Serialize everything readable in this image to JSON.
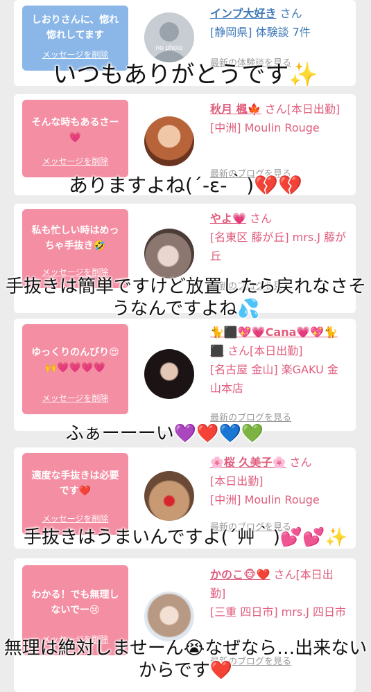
{
  "cards": [
    {
      "message": "しおりさんに、惚れ惚れしてます",
      "delete_label": "メッセージを削除",
      "avatar_label": "no photo",
      "name": "インプ大好き",
      "suffix": "さん",
      "area": "[静岡県] 体験談 7件",
      "latest": "最新の体験談を見る"
    },
    {
      "message": "そんな時もあるさー💗",
      "delete_label": "メッセージを削除",
      "name": "秋月 楓🍁",
      "suffix": "さん[本日出勤]",
      "area": "[中洲] Moulin Rouge",
      "latest": "最新のブログを見る"
    },
    {
      "message": "私も忙しい時はめっちゃ手抜き🤣",
      "delete_label": "メッセージを削除",
      "name": "やよ💗",
      "suffix": "さん",
      "area": "[名東区 藤が丘] mrs.J 藤が丘",
      "latest": "最新のブログを見る"
    },
    {
      "message": "ゆっくりのんびり😍🙌💗💗💗💗",
      "delete_label": "メッセージを削除",
      "name": "🐈⬛💖💗Cana💗💖🐈⬛",
      "suffix": "さん[本日出勤]",
      "area": "[名古屋 金山] 楽GAKU 金山本店",
      "latest": "最新のブログを見る"
    },
    {
      "message": "適度な手抜きは必要です❤️",
      "delete_label": "メッセージを削除",
      "name": "🌸桜 久美子🌸",
      "suffix": "さん",
      "status": "[本日出勤]",
      "area": "[中洲] Moulin Rouge",
      "latest": "最新のブログを見る"
    },
    {
      "message": "わかる！でも無理しないでー😢",
      "delete_label": "メッセージを削除",
      "name": "かのこ🐵❤️",
      "suffix": "さん[本日出勤]",
      "area": "[三重 四日市] mrs.J 四日市",
      "latest": "最新のブログを見る"
    }
  ],
  "overlays": [
    "いつもありがとうです✨",
    "ありますよね(´-ε-｀)💔💔",
    "手抜きは簡単ですけど放置したら戻れなさそうなんですよね💦",
    "ふぁーーーい💜❤️💙💚",
    "手抜きはうまいんですよ(´艸｀)💕💕✨",
    "無理は絶対しませーん😭なぜなら…出来ないからです❤️"
  ],
  "colors": {
    "pink_bubble": "#f48ea3",
    "blue_bubble": "#8bb7e8",
    "pink_text": "#e05d7d",
    "blue_text": "#3d78b8"
  }
}
